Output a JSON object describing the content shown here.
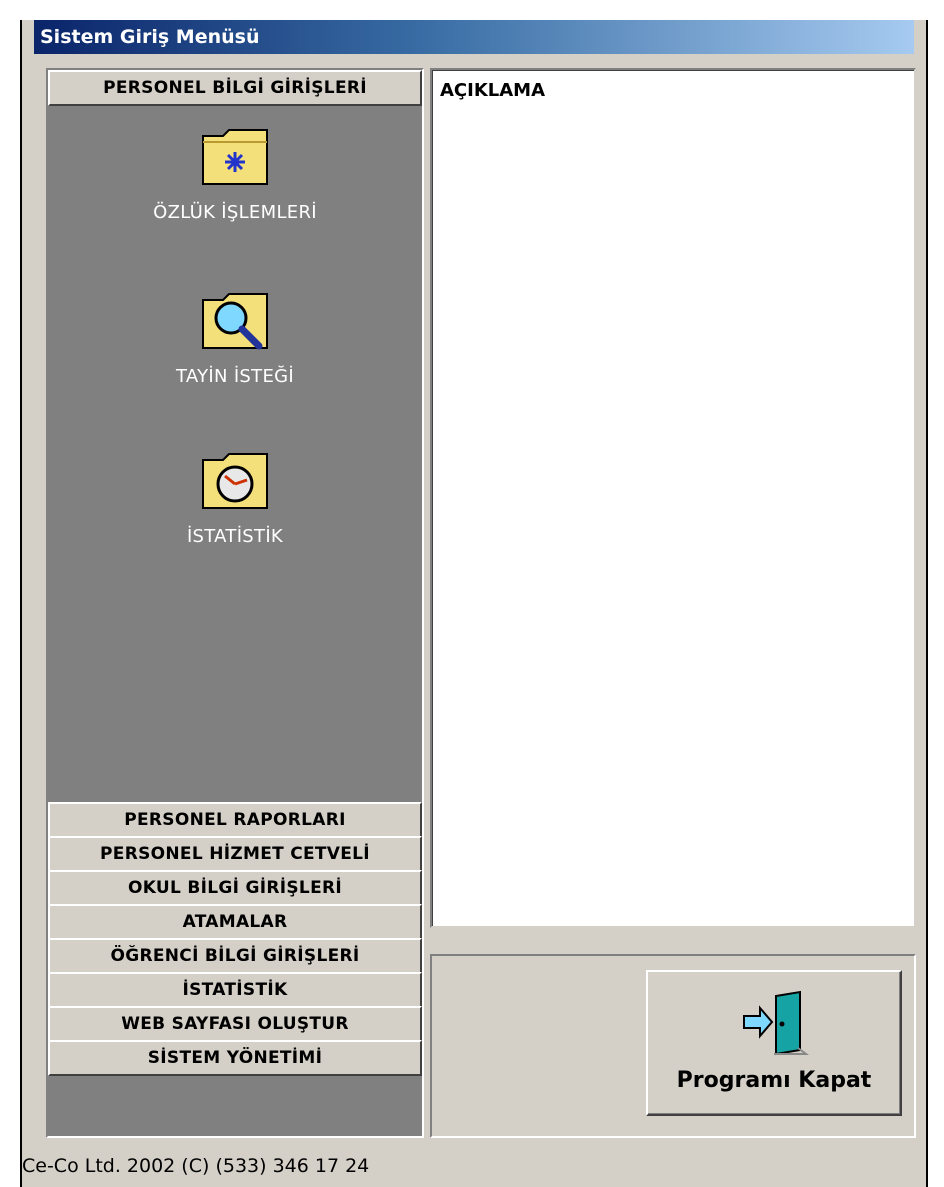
{
  "window": {
    "title": "Sistem Giriş Menüsü"
  },
  "menu": {
    "active_header": "PERSONEL BİLGİ GİRİŞLERİ",
    "active_items": [
      {
        "label": "ÖZLÜK İŞLEMLERİ",
        "icon": "folder-star-icon"
      },
      {
        "label": "TAYİN İSTEĞİ",
        "icon": "folder-magnifier-icon"
      },
      {
        "label": "İSTATİSTİK",
        "icon": "folder-clock-icon"
      }
    ],
    "headers": [
      "PERSONEL RAPORLARI",
      "PERSONEL HİZMET CETVELİ",
      "OKUL BİLGİ GİRİŞLERİ",
      "ATAMALAR",
      "ÖĞRENCİ BİLGİ GİRİŞLERİ",
      "İSTATİSTİK",
      "WEB SAYFASI OLUŞTUR",
      "SİSTEM YÖNETİMİ"
    ]
  },
  "description": {
    "title": "AÇIKLAMA"
  },
  "close_button": {
    "label": "Programı Kapat",
    "icon": "exit-door-icon"
  },
  "status": {
    "text": "Ce-Co Ltd. 2002 (C)  (533) 346 17 24"
  },
  "colors": {
    "title_start": "#0a246a",
    "title_end": "#a6caf0",
    "face": "#d4d0c8",
    "panel": "#808080"
  }
}
